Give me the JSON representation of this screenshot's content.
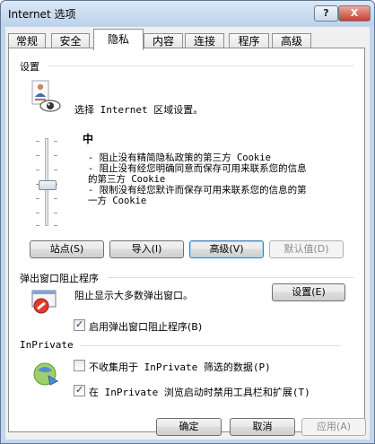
{
  "window": {
    "title": "Internet 选项",
    "help_label": "?",
    "close_label": "X"
  },
  "tabs": [
    {
      "label": "常规"
    },
    {
      "label": "安全"
    },
    {
      "label": "隐私"
    },
    {
      "label": "内容"
    },
    {
      "label": "连接"
    },
    {
      "label": "程序"
    },
    {
      "label": "高级"
    }
  ],
  "active_tab": "隐私",
  "settings": {
    "heading": "设置",
    "intro": "选择 Internet 区域设置。",
    "level": "中",
    "bullets": [
      "- 阻止没有精简隐私政策的第三方 Cookie",
      "- 阻止没有经您明确同意而保存可用来联系您的信息的第三方 Cookie",
      "- 限制没有经您默许而保存可用来联系您的信息的第一方 Cookie"
    ],
    "bullet_lines": [
      "- 阻止没有精简隐私政策的第三方 Cookie",
      "- 阻止没有经您明确同意而保存可用来联系您的信息",
      "  的第三方 Cookie",
      "- 限制没有经您默许而保存可用来联系您的信息的第",
      "  一方 Cookie"
    ],
    "buttons": {
      "sites": "站点(S)",
      "import": "导入(I)",
      "advanced": "高级(V)",
      "default": "默认值(D)"
    }
  },
  "popup": {
    "heading": "弹出窗口阻止程序",
    "desc": "阻止显示大多数弹出窗口。",
    "settings_button": "设置(E)",
    "enable_label": "启用弹出窗口阻止程序(B)",
    "enable_checked": true
  },
  "inprivate": {
    "heading": "InPrivate",
    "no_collect_label": "不收集用于 InPrivate 筛选的数据(P)",
    "no_collect_checked": false,
    "disable_toolbars_label": "在 InPrivate 浏览启动时禁用工具栏和扩展(T)",
    "disable_toolbars_checked": true
  },
  "footer": {
    "ok": "确定",
    "cancel": "取消",
    "apply": "应用(A)"
  }
}
